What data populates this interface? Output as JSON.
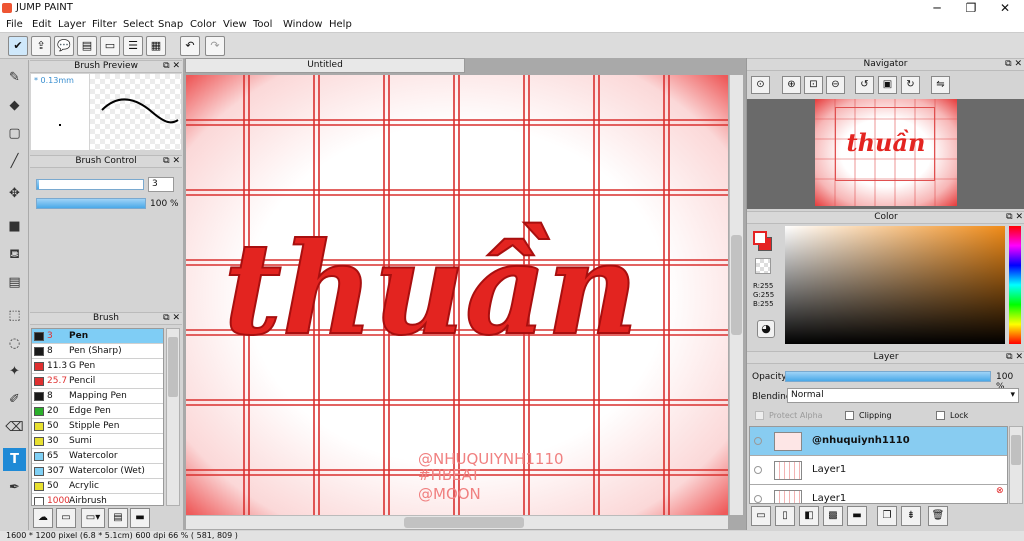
{
  "app": {
    "title": "JUMP PAINT"
  },
  "window_controls": {
    "minimize": "─",
    "maximize": "❐",
    "close": "✕"
  },
  "menu": [
    "File",
    "Edit",
    "Layer",
    "Filter",
    "Select",
    "Snap",
    "Color",
    "View",
    "Tool",
    "Window",
    "Help"
  ],
  "brush_preview": {
    "title": "Brush Preview",
    "size": "* 0.13mm"
  },
  "brush_control": {
    "title": "Brush Control",
    "size_value": "3",
    "opacity_value": "100 %",
    "opacity_fraction": 1.0
  },
  "brush_panel": {
    "title": "Brush",
    "items": [
      {
        "size": "3",
        "name": "Pen",
        "color": "#1a1a1a",
        "size_color": "#e03030",
        "selected": true
      },
      {
        "size": "8",
        "name": "Pen (Sharp)",
        "color": "#1a1a1a",
        "size_color": "#111"
      },
      {
        "size": "11.3",
        "name": "G Pen",
        "color": "#e03030",
        "size_color": "#111"
      },
      {
        "size": "25.7",
        "name": "Pencil",
        "color": "#e03030",
        "size_color": "#e03030"
      },
      {
        "size": "8",
        "name": "Mapping Pen",
        "color": "#1a1a1a",
        "size_color": "#111"
      },
      {
        "size": "20",
        "name": "Edge Pen",
        "color": "#2bb02b",
        "size_color": "#111"
      },
      {
        "size": "50",
        "name": "Stipple Pen",
        "color": "#e8e030",
        "size_color": "#111"
      },
      {
        "size": "30",
        "name": "Sumi",
        "color": "#e8e030",
        "size_color": "#111"
      },
      {
        "size": "65",
        "name": "Watercolor",
        "color": "#7fd0f5",
        "size_color": "#111"
      },
      {
        "size": "307",
        "name": "Watercolor (Wet)",
        "color": "#7fd0f5",
        "size_color": "#111"
      },
      {
        "size": "50",
        "name": "Acrylic",
        "color": "#e8e030",
        "size_color": "#111"
      },
      {
        "size": "1000",
        "name": "Airbrush",
        "color": "#ffffff",
        "size_color": "#e03030"
      }
    ]
  },
  "document": {
    "tab_title": "Untitled"
  },
  "artwork": {
    "main_text": "thuần",
    "watermark": [
      "@NHUQUIYNH1110",
      "#HBEAT",
      "@MOON"
    ]
  },
  "navigator": {
    "title": "Navigator"
  },
  "color_panel": {
    "title": "Color",
    "r": "R:255",
    "g": "G:255",
    "b": "B:255",
    "accent": "#e52222"
  },
  "layer_panel": {
    "title": "Layer",
    "opacity_label": "Opacity",
    "opacity_value": "100 %",
    "blending_label": "Blending",
    "blending_value": "Normal",
    "protect_alpha": "Protect Alpha",
    "clipping": "Clipping",
    "lock": "Lock",
    "layers": [
      {
        "name": "@nhuquiynh1110",
        "selected": true
      },
      {
        "name": "Layer1"
      },
      {
        "name": "Layer1"
      }
    ]
  },
  "status": {
    "text": "1600 * 1200 pixel   (6.8 * 5.1cm)   600 dpi   66 %   ( 581, 809 )"
  }
}
